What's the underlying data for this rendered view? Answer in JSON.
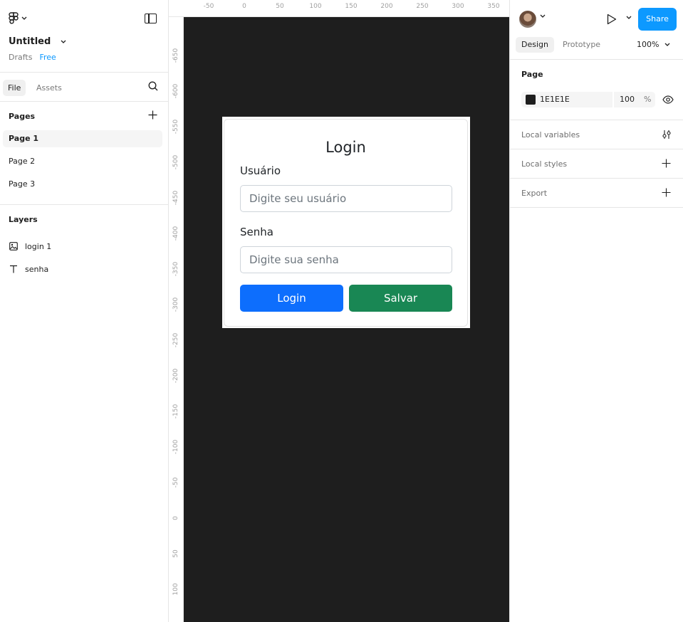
{
  "file": {
    "title": "Untitled",
    "location": "Drafts",
    "plan_badge": "Free"
  },
  "left_tabs": {
    "file": "File",
    "assets": "Assets"
  },
  "pages": {
    "title": "Pages",
    "items": [
      "Page 1",
      "Page 2",
      "Page 3"
    ]
  },
  "layers": {
    "title": "Layers",
    "items": [
      {
        "label": "login 1",
        "icon": "image-icon"
      },
      {
        "label": "senha",
        "icon": "text-icon"
      }
    ]
  },
  "rulers": {
    "top": [
      "-50",
      "0",
      "50",
      "100",
      "150",
      "200",
      "250",
      "300",
      "350"
    ],
    "left": [
      "-650",
      "-600",
      "-550",
      "-500",
      "-450",
      "-400",
      "-350",
      "-300",
      "-250",
      "-200",
      "-150",
      "-100",
      "-50",
      "0",
      "50",
      "100"
    ]
  },
  "login_form": {
    "title": "Login",
    "username_label": "Usuário",
    "username_placeholder": "Digite seu usuário",
    "password_label": "Senha",
    "password_placeholder": "Digite sua senha",
    "login_button": "Login",
    "save_button": "Salvar"
  },
  "right_panel": {
    "share_label": "Share",
    "tabs": {
      "design": "Design",
      "prototype": "Prototype"
    },
    "zoom": "100%",
    "page": {
      "title": "Page",
      "color_hex": "1E1E1E",
      "opacity": "100",
      "opacity_unit": "%"
    },
    "sections": [
      "Local variables",
      "Local styles",
      "Export"
    ]
  },
  "colors": {
    "accent": "#0d99ff",
    "canvas": "#1e1e1e",
    "login_button": "#0d6efd",
    "save_button": "#198754"
  }
}
